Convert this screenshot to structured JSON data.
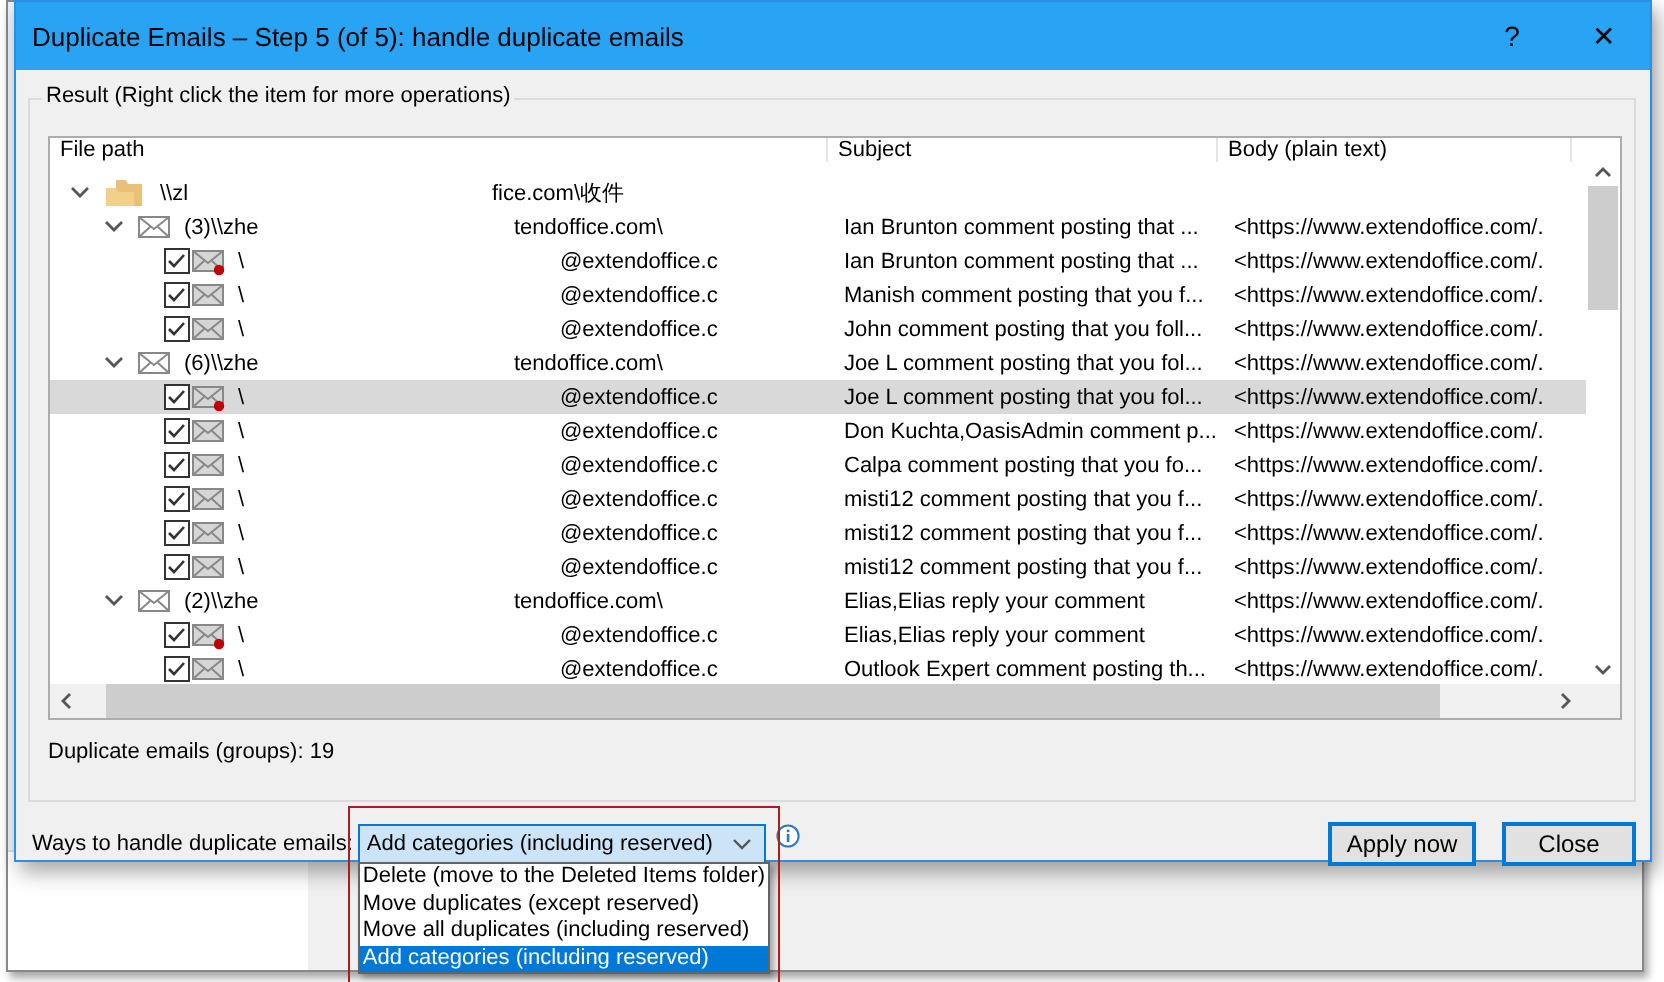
{
  "window": {
    "title": "Duplicate Emails – Step 5 (of 5): handle duplicate emails",
    "controls": [
      "?",
      "✕"
    ]
  },
  "result": {
    "caption": "Result (Right click the item for more operations)",
    "columns": [
      "File path",
      "Subject",
      "Body (plain text)"
    ],
    "tree": [
      {
        "kind": "folder",
        "expanded": true,
        "path_start": "\\\\zl",
        "path_end": "fice.com\\收件",
        "children": [
          {
            "kind": "group",
            "expanded": true,
            "path_start": "(3)\\\\zhe",
            "path_end": "tendoffice.com\\",
            "subject": "Ian Brunton comment posting that ...",
            "body": "<https://www.extendoffice.com/.",
            "children": [
              {
                "kind": "mail",
                "checked": true,
                "unread": true,
                "selected": false,
                "path_start": "\\",
                "path_end": "@extendoffice.c",
                "subject": "Ian Brunton comment posting that ...",
                "body": "<https://www.extendoffice.com/."
              },
              {
                "kind": "mail",
                "checked": true,
                "unread": false,
                "selected": false,
                "path_start": "\\",
                "path_end": "@extendoffice.c",
                "subject": "Manish comment posting that you f...",
                "body": "<https://www.extendoffice.com/."
              },
              {
                "kind": "mail",
                "checked": true,
                "unread": false,
                "selected": false,
                "path_start": "\\",
                "path_end": "@extendoffice.c",
                "subject": "John comment posting that you foll...",
                "body": "<https://www.extendoffice.com/."
              }
            ]
          },
          {
            "kind": "group",
            "expanded": true,
            "path_start": "(6)\\\\zhe",
            "path_end": "tendoffice.com\\",
            "subject": "Joe L comment posting that you fol...",
            "body": "<https://www.extendoffice.com/.",
            "children": [
              {
                "kind": "mail",
                "checked": true,
                "unread": true,
                "selected": true,
                "path_start": "\\",
                "path_end": "@extendoffice.c",
                "subject": "Joe L comment posting that you fol...",
                "body": "<https://www.extendoffice.com/."
              },
              {
                "kind": "mail",
                "checked": true,
                "unread": false,
                "selected": false,
                "path_start": "\\",
                "path_end": "@extendoffice.c",
                "subject": "Don Kuchta,OasisAdmin comment p...",
                "body": "<https://www.extendoffice.com/."
              },
              {
                "kind": "mail",
                "checked": true,
                "unread": false,
                "selected": false,
                "path_start": "\\",
                "path_end": "@extendoffice.c",
                "subject": "Calpa comment posting that you fo...",
                "body": "<https://www.extendoffice.com/."
              },
              {
                "kind": "mail",
                "checked": true,
                "unread": false,
                "selected": false,
                "path_start": "\\",
                "path_end": "@extendoffice.c",
                "subject": "misti12 comment posting that you f...",
                "body": "<https://www.extendoffice.com/."
              },
              {
                "kind": "mail",
                "checked": true,
                "unread": false,
                "selected": false,
                "path_start": "\\",
                "path_end": "@extendoffice.c",
                "subject": "misti12 comment posting that you f...",
                "body": "<https://www.extendoffice.com/."
              },
              {
                "kind": "mail",
                "checked": true,
                "unread": false,
                "selected": false,
                "path_start": "\\",
                "path_end": "@extendoffice.c",
                "subject": "misti12 comment posting that you f...",
                "body": "<https://www.extendoffice.com/."
              }
            ]
          },
          {
            "kind": "group",
            "expanded": true,
            "path_start": "(2)\\\\zhe",
            "path_end": "tendoffice.com\\",
            "subject": "Elias,Elias reply your comment",
            "body": "<https://www.extendoffice.com/.",
            "children": [
              {
                "kind": "mail",
                "checked": true,
                "unread": true,
                "selected": false,
                "path_start": "\\",
                "path_end": "@extendoffice.c",
                "subject": "Elias,Elias reply your comment",
                "body": "<https://www.extendoffice.com/."
              },
              {
                "kind": "mail",
                "checked": true,
                "unread": false,
                "selected": false,
                "path_start": "\\",
                "path_end": "@extendoffice.c",
                "subject": "Outlook Expert comment posting th...",
                "body": "<https://www.extendoffice.com/."
              }
            ]
          }
        ]
      }
    ],
    "count": "Duplicate emails (groups): 19"
  },
  "handling": {
    "label": "Ways to handle duplicate emails:",
    "value": "Add categories (including reserved)",
    "expanded": true,
    "options": [
      {
        "label": "Delete (move to the Deleted Items folder)",
        "selected": false
      },
      {
        "label": "Move duplicates (except reserved)",
        "selected": false
      },
      {
        "label": "Move all duplicates (including reserved)",
        "selected": false
      },
      {
        "label": "Add categories (including reserved)",
        "selected": true
      }
    ]
  },
  "buttons": [
    "Apply now",
    "Close"
  ]
}
